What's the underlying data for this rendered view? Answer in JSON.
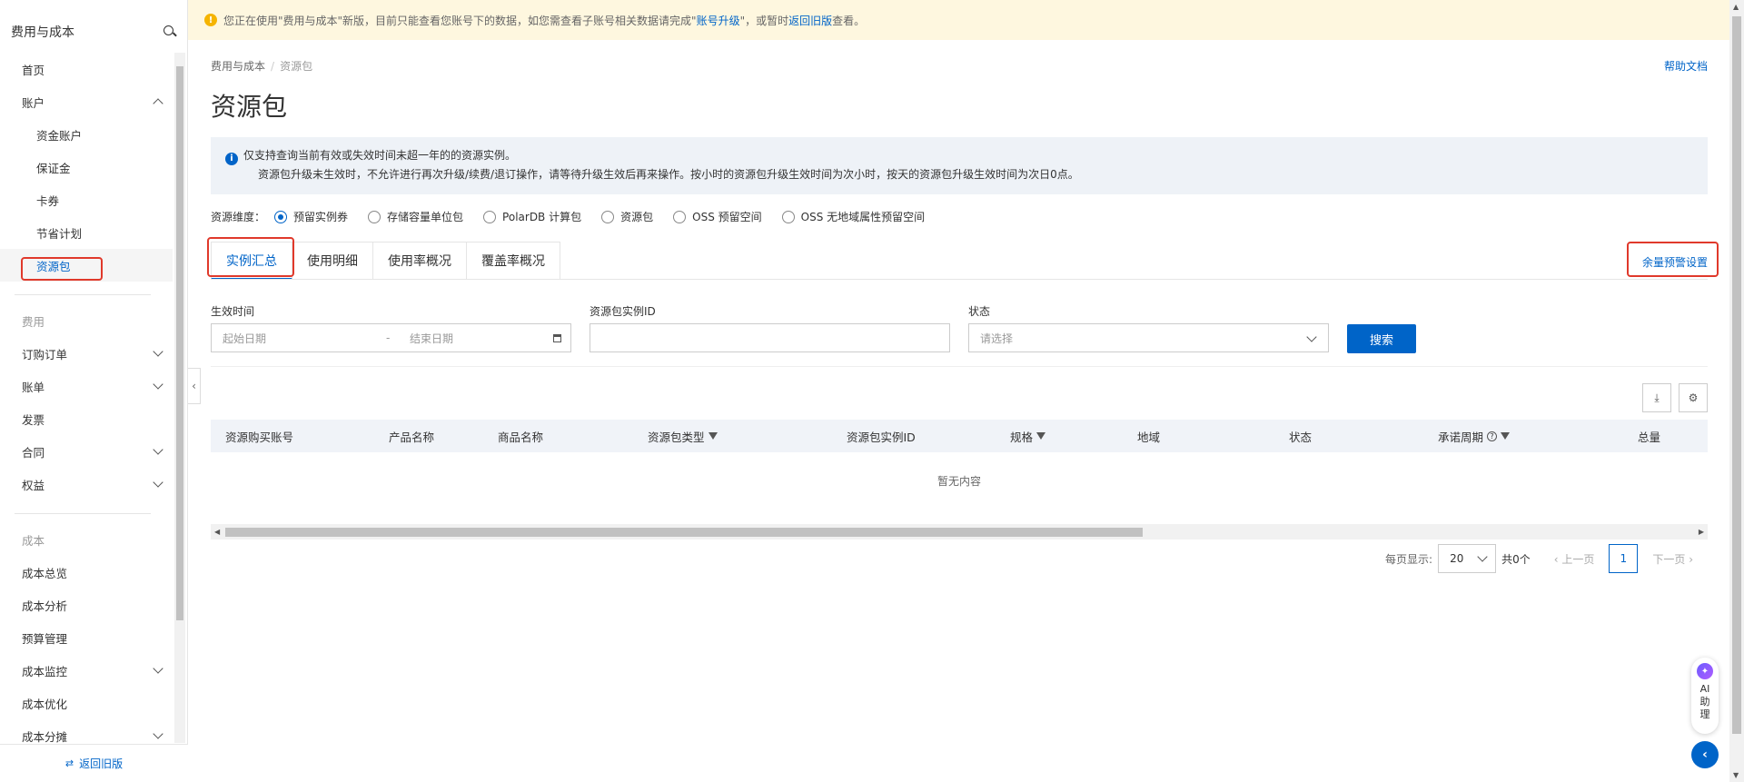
{
  "sidebar": {
    "title": "费用与成本",
    "items": [
      {
        "label": "首页"
      },
      {
        "label": "账户"
      },
      {
        "label": "资金账户"
      },
      {
        "label": "保证金"
      },
      {
        "label": "卡券"
      },
      {
        "label": "节省计划"
      },
      {
        "label": "资源包"
      }
    ],
    "group_fee": "费用",
    "fee_items": [
      {
        "label": "订购订单"
      },
      {
        "label": "账单"
      },
      {
        "label": "发票"
      },
      {
        "label": "合同"
      },
      {
        "label": "权益"
      }
    ],
    "group_cost": "成本",
    "cost_items": [
      {
        "label": "成本总览"
      },
      {
        "label": "成本分析"
      },
      {
        "label": "预算管理"
      },
      {
        "label": "成本监控"
      },
      {
        "label": "成本优化"
      },
      {
        "label": "成本分摊"
      }
    ],
    "footer": "返回旧版",
    "footer_icon": "⇄"
  },
  "notice": {
    "text_before": "您正在使用\"费用与成本\"新版，目前只能查看您账号下的数据，如您需查看子账号相关数据请完成\"",
    "link1": "账号升级",
    "text_mid": "\"，或暂时",
    "link2": "返回旧版",
    "text_after": "查看。"
  },
  "breadcrumb": {
    "root": "费用与成本",
    "sep": "/",
    "current": "资源包"
  },
  "help": "帮助文档",
  "page_title": "资源包",
  "info": {
    "line1": "仅支持查询当前有效或失效时间未超一年的的资源实例。",
    "line2": "资源包升级未生效时，不允许进行再次升级/续费/退订操作，请等待升级生效后再来操作。按小时的资源包升级生效时间为次小时，按天的资源包升级生效时间为次日0点。"
  },
  "dimension": {
    "label": "资源维度：",
    "options": [
      "预留实例券",
      "存储容量单位包",
      "PolarDB 计算包",
      "资源包",
      "OSS 预留空间",
      "OSS 无地域属性预留空间"
    ],
    "selected": "预留实例券"
  },
  "tabs": [
    "实例汇总",
    "使用明细",
    "使用率概况",
    "覆盖率概况"
  ],
  "active_tab": "实例汇总",
  "surplus_link": "余量预警设置",
  "filters": {
    "effective_label": "生效时间",
    "start_placeholder": "起始日期",
    "range_sep": "-",
    "end_placeholder": "结束日期",
    "instance_label": "资源包实例ID",
    "instance_value": "",
    "status_label": "状态",
    "status_placeholder": "请选择",
    "search": "搜索"
  },
  "table": {
    "columns": [
      "资源购买账号",
      "产品名称",
      "商品名称",
      "资源包类型",
      "资源包实例ID",
      "规格",
      "地域",
      "状态",
      "承诺周期",
      "总量"
    ],
    "empty": "暂无内容"
  },
  "pager": {
    "per_page_label": "每页显示:",
    "per_page": "20",
    "total": "共0个",
    "prev": "上一页",
    "page": "1",
    "next": "下一页"
  },
  "ai": {
    "label1": "AI",
    "label2": "助",
    "label3": "理"
  },
  "colors": {
    "primary": "#0064c8",
    "notice_bg": "#fef7df",
    "highlight": "#e0392b"
  }
}
